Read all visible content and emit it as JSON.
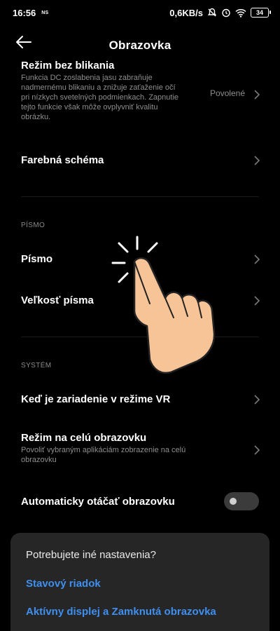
{
  "status": {
    "time": "16:56",
    "ns_label": "NS",
    "speed": "0,6KB/s",
    "battery": "34"
  },
  "header": {
    "title": "Obrazovka"
  },
  "rows": {
    "flicker": {
      "title": "Režim bez blikania",
      "desc_lines": [
        "Funkcia DC zoslabenia jasu zabraňuje",
        "nadmernému blikaniu a znižuje zaťaženie očí",
        "pri nízkych svetelných podmienkach. Zapnutie",
        "tejto funkcie však môže ovplyvniť kvalitu",
        "obrázku."
      ],
      "value": "Povolené"
    },
    "color_scheme": {
      "title": "Farebná schéma"
    },
    "font": {
      "title": "Písmo"
    },
    "font_size": {
      "title": "Veľkosť písma"
    },
    "vr": {
      "title": "Keď je zariadenie v režime VR"
    },
    "fullscreen": {
      "title": "Režim na celú obrazovku",
      "desc_lines": [
        "Povoliť vybraným aplikáciám zobrazenie na celú",
        "obrazovku"
      ]
    },
    "autorotate": {
      "title": "Automaticky otáčať obrazovku",
      "enabled": false
    }
  },
  "sections": {
    "font": "PÍSMO",
    "system": "SYSTÉM"
  },
  "sheet": {
    "title": "Potrebujete iné nastavenia?",
    "links": [
      "Stavový riadok",
      "Aktívny displej a Zamknutá obrazovka"
    ]
  },
  "colors": {
    "background": "#000000",
    "accent": "#3f8ff0",
    "sheet": "#262626",
    "hand": "#f6c497"
  }
}
